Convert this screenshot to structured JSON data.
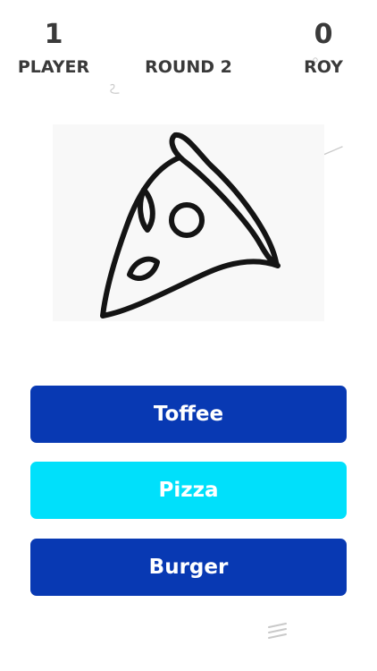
{
  "scoreboard": {
    "player": {
      "score": "1",
      "name": "PLAYER"
    },
    "round": "ROUND 2",
    "opponent": {
      "score": "0",
      "name": "ROY"
    }
  },
  "drawing": {
    "icon": "pizza-slice-drawing"
  },
  "answers": [
    {
      "label": "Toffee",
      "color": "#0839b3"
    },
    {
      "label": "Pizza",
      "color": "#00e0fb"
    },
    {
      "label": "Burger",
      "color": "#0839b3"
    }
  ],
  "colors": {
    "text": "#3a3a3a",
    "primary": "#0839b3",
    "highlight": "#00e0fb"
  }
}
